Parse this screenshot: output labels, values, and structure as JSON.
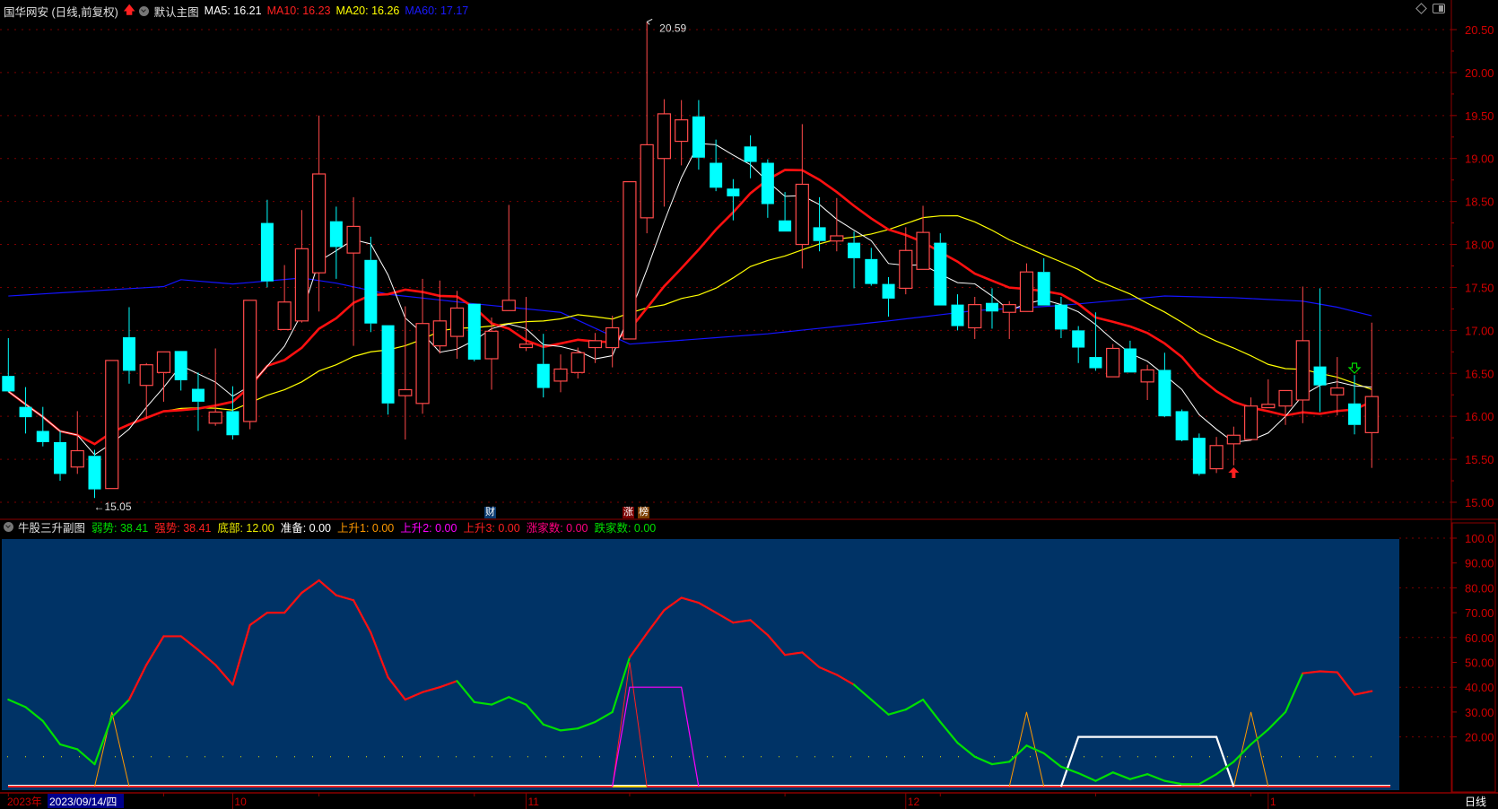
{
  "header": {
    "title": "国华网安 (日线,前复权)",
    "main_chart_label": "默认主图",
    "ma_labels": [
      {
        "text": "MA5: 16.21",
        "color": "#ffffff"
      },
      {
        "text": "MA10: 16.23",
        "color": "#ff2020"
      },
      {
        "text": "MA20: 16.26",
        "color": "#ffff00"
      },
      {
        "text": "MA60: 17.17",
        "color": "#1a1aff"
      }
    ]
  },
  "indicator_header": {
    "name": "牛股三升副图",
    "items": [
      {
        "text": "弱势: 38.41",
        "color": "#00e000"
      },
      {
        "text": "强势: 38.41",
        "color": "#ff2020"
      },
      {
        "text": "底部: 12.00",
        "color": "#e8e800"
      },
      {
        "text": "准备: 0.00",
        "color": "#ffffff"
      },
      {
        "text": "上升1: 0.00",
        "color": "#ff9900"
      },
      {
        "text": "上升2: 0.00",
        "color": "#ff00ff"
      },
      {
        "text": "上升3: 0.00",
        "color": "#ff2020"
      },
      {
        "text": "涨家数: 0.00",
        "color": "#ff0080"
      },
      {
        "text": "跌家数: 0.00",
        "color": "#00e000"
      }
    ]
  },
  "badges": {
    "finance": "财",
    "limit_up": "涨",
    "list": "榜"
  },
  "time_axis": {
    "year": "2023年",
    "cursor_date": "2023/09/14/四",
    "months": [
      {
        "label": "10",
        "bar": 14
      },
      {
        "label": "11",
        "bar": 31
      },
      {
        "label": "12",
        "bar": 53
      },
      {
        "label": "1",
        "bar": 74
      }
    ],
    "period": "日线"
  },
  "chart_data": {
    "type": "candlestick",
    "colors": {
      "up": "#ff4a4a",
      "down": "#00ffff",
      "ma5": "#ffffff",
      "ma10": "#ff1010",
      "ma20": "#ffff00",
      "ma60": "#1414ff"
    },
    "price_ticks": [
      20.5,
      20.0,
      19.5,
      19.0,
      18.5,
      18.0,
      17.5,
      17.0,
      16.5,
      16.0,
      15.5,
      15.0
    ],
    "price_range": [
      15.0,
      20.5
    ],
    "candles_ohlc": [
      [
        16.47,
        16.91,
        16.28,
        16.29
      ],
      [
        16.11,
        16.34,
        15.8,
        15.99
      ],
      [
        15.83,
        16.11,
        15.65,
        15.7
      ],
      [
        15.7,
        15.83,
        15.25,
        15.33
      ],
      [
        15.41,
        16.06,
        15.33,
        15.6
      ],
      [
        15.54,
        15.61,
        15.05,
        15.15
      ],
      [
        15.16,
        16.65,
        15.16,
        16.65
      ],
      [
        16.92,
        17.27,
        16.38,
        16.53
      ],
      [
        16.36,
        16.62,
        15.97,
        16.6
      ],
      [
        16.51,
        16.75,
        16.17,
        16.75
      ],
      [
        16.76,
        16.76,
        16.3,
        16.42
      ],
      [
        16.32,
        16.51,
        15.83,
        16.17
      ],
      [
        15.92,
        16.79,
        15.89,
        16.05
      ],
      [
        16.06,
        16.35,
        15.73,
        15.78
      ],
      [
        15.94,
        17.35,
        15.85,
        17.35
      ],
      [
        18.25,
        18.52,
        17.5,
        17.57
      ],
      [
        17.01,
        17.76,
        17.01,
        17.33
      ],
      [
        17.11,
        18.4,
        17.09,
        17.95
      ],
      [
        17.67,
        19.5,
        17.22,
        18.82
      ],
      [
        18.27,
        18.44,
        17.6,
        17.97
      ],
      [
        17.9,
        18.55,
        16.82,
        18.21
      ],
      [
        17.82,
        18.09,
        16.98,
        17.08
      ],
      [
        17.06,
        17.06,
        16.02,
        16.15
      ],
      [
        16.24,
        17.28,
        15.73,
        16.31
      ],
      [
        16.15,
        17.6,
        16.03,
        17.08
      ],
      [
        16.82,
        17.58,
        16.73,
        17.11
      ],
      [
        16.93,
        17.46,
        16.67,
        17.26
      ],
      [
        17.31,
        17.31,
        16.64,
        16.66
      ],
      [
        16.67,
        17.15,
        16.31,
        16.99
      ],
      [
        17.23,
        18.46,
        17.23,
        17.35
      ],
      [
        16.8,
        17.39,
        16.76,
        16.84
      ],
      [
        16.61,
        16.96,
        16.22,
        16.33
      ],
      [
        16.41,
        16.72,
        16.28,
        16.55
      ],
      [
        16.51,
        16.8,
        16.44,
        16.74
      ],
      [
        16.8,
        16.97,
        16.62,
        16.88
      ],
      [
        16.8,
        17.17,
        16.57,
        17.03
      ],
      [
        16.9,
        18.73,
        16.9,
        18.73
      ],
      [
        18.31,
        20.59,
        18.13,
        19.16
      ],
      [
        19.0,
        19.69,
        18.44,
        19.52
      ],
      [
        19.2,
        19.68,
        18.92,
        19.45
      ],
      [
        19.49,
        19.68,
        18.87,
        19.01
      ],
      [
        18.95,
        19.22,
        18.62,
        18.66
      ],
      [
        18.65,
        18.76,
        18.28,
        18.56
      ],
      [
        19.14,
        19.27,
        18.77,
        18.96
      ],
      [
        18.95,
        18.99,
        18.31,
        18.47
      ],
      [
        18.28,
        18.61,
        18.15,
        18.15
      ],
      [
        18.0,
        19.4,
        17.72,
        18.7
      ],
      [
        18.2,
        18.55,
        17.92,
        18.04
      ],
      [
        18.04,
        18.54,
        17.92,
        18.1
      ],
      [
        18.02,
        18.15,
        17.49,
        17.84
      ],
      [
        17.83,
        17.96,
        17.52,
        17.54
      ],
      [
        17.54,
        17.62,
        17.16,
        17.37
      ],
      [
        17.49,
        18.2,
        17.42,
        17.93
      ],
      [
        17.71,
        18.45,
        17.71,
        18.14
      ],
      [
        18.02,
        18.13,
        17.29,
        17.29
      ],
      [
        17.3,
        17.42,
        17.0,
        17.05
      ],
      [
        17.03,
        17.39,
        16.9,
        17.3
      ],
      [
        17.32,
        17.49,
        17.02,
        17.22
      ],
      [
        17.21,
        17.34,
        16.9,
        17.3
      ],
      [
        17.22,
        17.78,
        17.22,
        17.68
      ],
      [
        17.68,
        17.84,
        17.29,
        17.29
      ],
      [
        17.3,
        17.39,
        16.91,
        17.01
      ],
      [
        17.0,
        17.05,
        16.62,
        16.8
      ],
      [
        16.69,
        17.21,
        16.53,
        16.56
      ],
      [
        16.46,
        16.84,
        16.46,
        16.79
      ],
      [
        16.79,
        16.88,
        16.51,
        16.51
      ],
      [
        16.4,
        16.6,
        16.19,
        16.54
      ],
      [
        16.54,
        16.74,
        15.99,
        16.0
      ],
      [
        16.06,
        16.08,
        15.71,
        15.72
      ],
      [
        15.75,
        15.8,
        15.31,
        15.33
      ],
      [
        15.39,
        15.76,
        15.34,
        15.66
      ],
      [
        15.68,
        15.88,
        15.43,
        15.78
      ],
      [
        15.73,
        16.22,
        15.73,
        16.12
      ],
      [
        16.1,
        16.43,
        16.1,
        16.14
      ],
      [
        16.12,
        16.3,
        15.9,
        16.3
      ],
      [
        16.19,
        17.51,
        15.92,
        16.88
      ],
      [
        16.58,
        17.49,
        16.05,
        16.36
      ],
      [
        16.25,
        16.69,
        16.01,
        16.33
      ],
      [
        16.15,
        16.48,
        15.79,
        15.9
      ],
      [
        15.81,
        17.09,
        15.4,
        16.23
      ]
    ],
    "ma60_points": [
      [
        1,
        17.4
      ],
      [
        10,
        17.51
      ],
      [
        11,
        17.59
      ],
      [
        14,
        17.54
      ],
      [
        18,
        17.61
      ],
      [
        20,
        17.55
      ],
      [
        23,
        17.42
      ],
      [
        28,
        17.31
      ],
      [
        33,
        17.21
      ],
      [
        37,
        16.84
      ],
      [
        45,
        16.96
      ],
      [
        52,
        17.11
      ],
      [
        57,
        17.23
      ],
      [
        62,
        17.29
      ],
      [
        68,
        17.4
      ],
      [
        72,
        17.38
      ],
      [
        76,
        17.34
      ],
      [
        78,
        17.27
      ],
      [
        80,
        17.17
      ]
    ],
    "annotations": {
      "high_label": "20.59",
      "high_bar": 38,
      "low_label": "15.05",
      "low_bar": 6,
      "buy_signal_bar": 72,
      "sell_signal_bar": 79
    },
    "indicator": {
      "ticks": [
        "100.0",
        "90.00",
        "80.00",
        "70.00",
        "60.00",
        "50.00",
        "40.00",
        "30.00",
        "20.00"
      ],
      "tick_values": [
        100,
        90,
        80,
        70,
        60,
        50,
        40,
        30,
        20
      ],
      "range": [
        0,
        100
      ],
      "background": "#003366",
      "strength": [
        35,
        32,
        26.4,
        17,
        15,
        9,
        28,
        35,
        49,
        60.5,
        60.5,
        55,
        49,
        41,
        65,
        70,
        70,
        78,
        83,
        77,
        75,
        62,
        44,
        35,
        38,
        40,
        42.5,
        34,
        33,
        36,
        33,
        25,
        22.6,
        23.4,
        26,
        30,
        52,
        61.7,
        71,
        76,
        74,
        70,
        66,
        67,
        61,
        53,
        54,
        48,
        45,
        41,
        35,
        29,
        31,
        35,
        26,
        17.6,
        12,
        9,
        10,
        16.5,
        13.4,
        8,
        5.4,
        2.3,
        5.7,
        3,
        5,
        2.3,
        1,
        1,
        5,
        10,
        17,
        23,
        30,
        45.6,
        46.4,
        46,
        37,
        38.41
      ],
      "strong_ranges": [
        [
          8,
          27
        ],
        [
          37,
          50
        ],
        [
          76,
          80
        ]
      ],
      "weak_color": "#00e000",
      "strong_color": "#ff1010",
      "bottom_level": 12,
      "rise1_spikes": [
        {
          "bar": 7,
          "value": 30
        },
        {
          "bar": 60,
          "value": 30
        },
        {
          "bar": 73,
          "value": 30
        }
      ],
      "rise3_spikes": [
        {
          "bar": 37,
          "value": 50
        }
      ],
      "rise2_plateau": {
        "from": 36,
        "top_from": 37,
        "top_to": 40,
        "to": 41,
        "value": 40
      },
      "ready_plateau": {
        "from": 62,
        "top_from": 63,
        "top_to": 71,
        "to": 72,
        "value": 20
      }
    }
  }
}
